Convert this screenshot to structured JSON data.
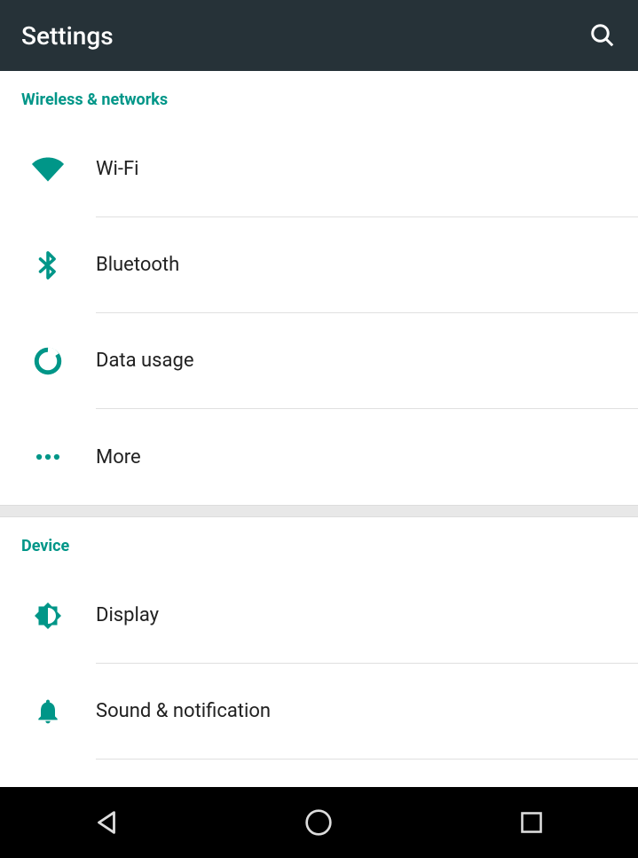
{
  "header": {
    "title": "Settings"
  },
  "accent_color": "#009688",
  "sections": [
    {
      "title": "Wireless & networks",
      "items": [
        {
          "label": "Wi-Fi",
          "icon": "wifi"
        },
        {
          "label": "Bluetooth",
          "icon": "bluetooth"
        },
        {
          "label": "Data usage",
          "icon": "data-usage"
        },
        {
          "label": "More",
          "icon": "more"
        }
      ]
    },
    {
      "title": "Device",
      "items": [
        {
          "label": "Display",
          "icon": "display"
        },
        {
          "label": "Sound & notification",
          "icon": "notification"
        }
      ]
    }
  ]
}
